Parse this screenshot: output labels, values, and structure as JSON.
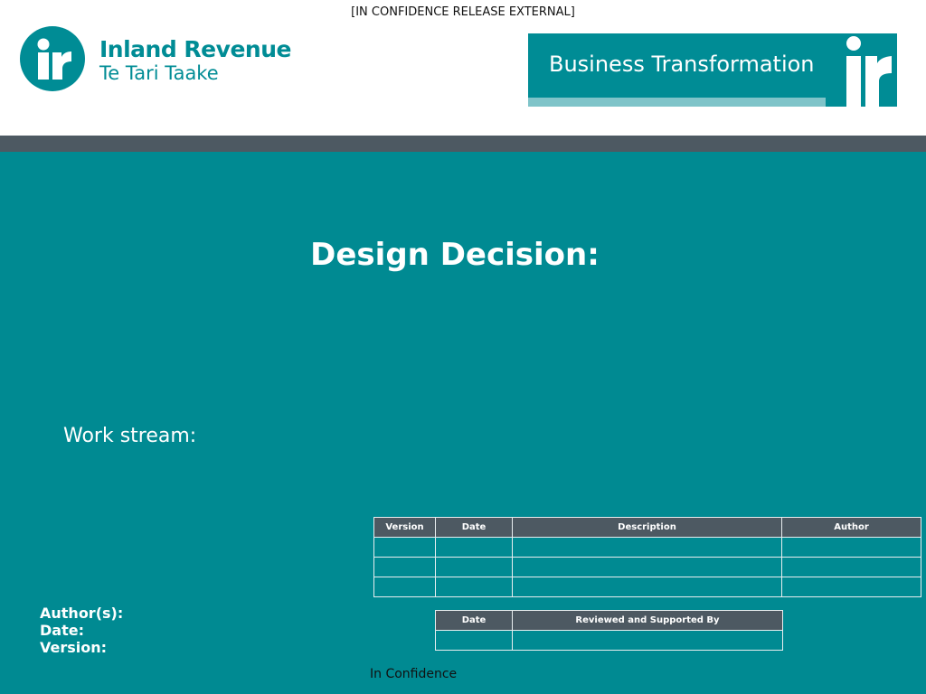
{
  "header": {
    "classification": "[IN CONFIDENCE RELEASE EXTERNAL]",
    "logo": {
      "name": "Inland Revenue",
      "subtitle": "Te Tari Taake",
      "brand_color": "#008c95"
    },
    "banner": {
      "text": "Business Transformation",
      "color": "#008c95",
      "strip_color": "#7fc4c9"
    }
  },
  "colors": {
    "band": "#4d5962",
    "body_background": "#008a92",
    "table_header": "#4d5962"
  },
  "main": {
    "title": "Design Decision:",
    "workstream_label": "Work stream:"
  },
  "version_table": {
    "headers": [
      "Version",
      "Date",
      "Description",
      "Author"
    ],
    "rows": [
      [
        "",
        "",
        "",
        ""
      ],
      [
        "",
        "",
        "",
        ""
      ],
      [
        "",
        "",
        "",
        ""
      ]
    ]
  },
  "review_table": {
    "headers": [
      "Date",
      "Reviewed and Supported By"
    ],
    "rows": [
      [
        "",
        ""
      ]
    ]
  },
  "meta": {
    "authors_label": "Author(s):",
    "date_label": "Date:",
    "version_label": "Version:"
  },
  "footer": {
    "text": "In Confidence"
  }
}
